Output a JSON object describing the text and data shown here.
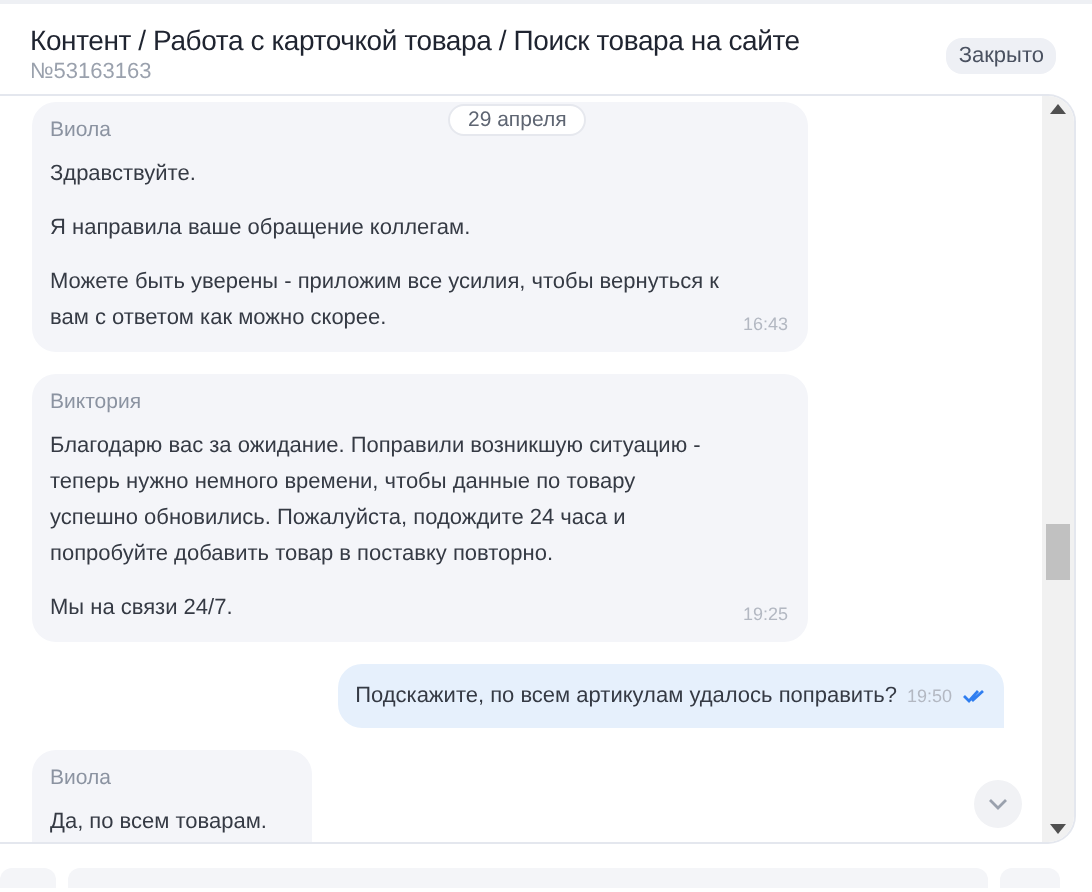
{
  "header": {
    "title": "Контент / Работа с карточкой товара / Поиск товара на сайте",
    "ticket_number": "№53163163",
    "status": "Закрыто"
  },
  "date_chip": "29 апреля",
  "messages": [
    {
      "kind": "incoming",
      "author": "Виола",
      "paragraphs": [
        "Здравствуйте.",
        "Я направила ваше обращение коллегам.",
        "Можете быть уверены - приложим все усилия, чтобы вернуться к вам с ответом как можно скорее."
      ],
      "time": "16:43"
    },
    {
      "kind": "incoming",
      "author": "Виктория",
      "paragraphs": [
        "Благодарю вас за ожидание. Поправили возникшую ситуацию - теперь нужно немного времени, чтобы данные по товару успешно обновились. Пожалуйста, подождите 24 часа и попробуйте добавить товар в поставку повторно.",
        "Мы на связи 24/7."
      ],
      "time": "19:25"
    },
    {
      "kind": "outgoing",
      "paragraphs": [
        "Подскажите, по всем артикулам удалось поправить?"
      ],
      "time": "19:50",
      "read": true
    },
    {
      "kind": "incoming",
      "author": "Виола",
      "paragraphs": [
        "Да, по всем товарам."
      ]
    }
  ]
}
